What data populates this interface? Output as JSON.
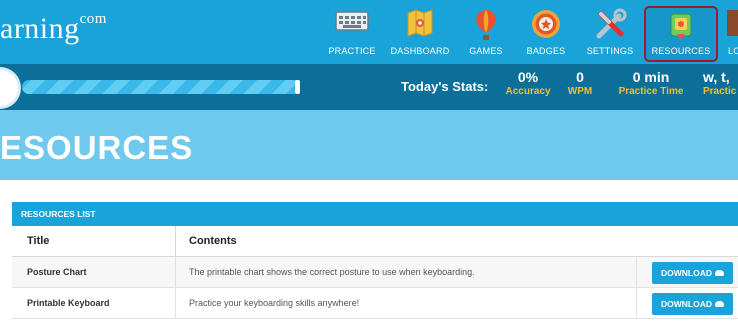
{
  "brand": {
    "name": "arning",
    "suffix": "com"
  },
  "nav": {
    "items": [
      {
        "label": "PRACTICE",
        "icon": "keyboard-icon"
      },
      {
        "label": "DASHBOARD",
        "icon": "map-icon"
      },
      {
        "label": "GAMES",
        "icon": "balloon-icon"
      },
      {
        "label": "BADGES",
        "icon": "badge-icon"
      },
      {
        "label": "SETTINGS",
        "icon": "tools-icon"
      },
      {
        "label": "RESOURCES",
        "icon": "certificate-icon"
      },
      {
        "label": "LO",
        "icon": "door-icon"
      }
    ],
    "active_color": "#9b1c2c"
  },
  "stats": {
    "title": "Today's Stats:",
    "items": [
      {
        "value": "0%",
        "label": "Accuracy"
      },
      {
        "value": "0",
        "label": "WPM"
      },
      {
        "value": "0 min",
        "label": "Practice Time"
      },
      {
        "value": "w, t,",
        "label": "Practic"
      }
    ]
  },
  "page": {
    "heading": "ESOURCES"
  },
  "resources": {
    "panel_title": "RESOURCES LIST",
    "columns": [
      "Title",
      "Contents"
    ],
    "rows": [
      {
        "title": "Posture Chart",
        "contents": "The printable chart shows the correct posture to use when keyboarding.",
        "action": "DOWNLOAD"
      },
      {
        "title": "Printable Keyboard",
        "contents": "Practice your keyboarding skills anywhere!",
        "action": "DOWNLOAD"
      }
    ]
  },
  "colors": {
    "primary": "#1aa3d9",
    "dark": "#0b6f99",
    "light": "#6fc8ee",
    "accent": "#f5c02a"
  }
}
